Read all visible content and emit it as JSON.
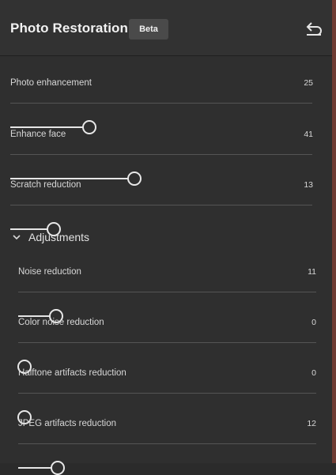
{
  "header": {
    "title": "Photo Restoration",
    "badge": "Beta",
    "reset_icon": "undo-icon"
  },
  "sliders": [
    {
      "label": "Photo enhancement",
      "value": "25"
    },
    {
      "label": "Enhance face",
      "value": "41"
    },
    {
      "label": "Scratch reduction",
      "value": "13"
    }
  ],
  "adjustments": {
    "label": "Adjustments",
    "expanded": true,
    "chevron_icon": "chevron-down-icon",
    "sliders": [
      {
        "label": "Noise reduction",
        "value": "11"
      },
      {
        "label": "Color noise reduction",
        "value": "0"
      },
      {
        "label": "Halftone artifacts reduction",
        "value": "0"
      },
      {
        "label": "JPEG artifacts reduction",
        "value": "12"
      }
    ]
  },
  "colors": {
    "panel_bg": "#2f2f2f",
    "track": "#555555",
    "fill": "#e6e6e6",
    "accent_edge": "#6e3b33"
  }
}
